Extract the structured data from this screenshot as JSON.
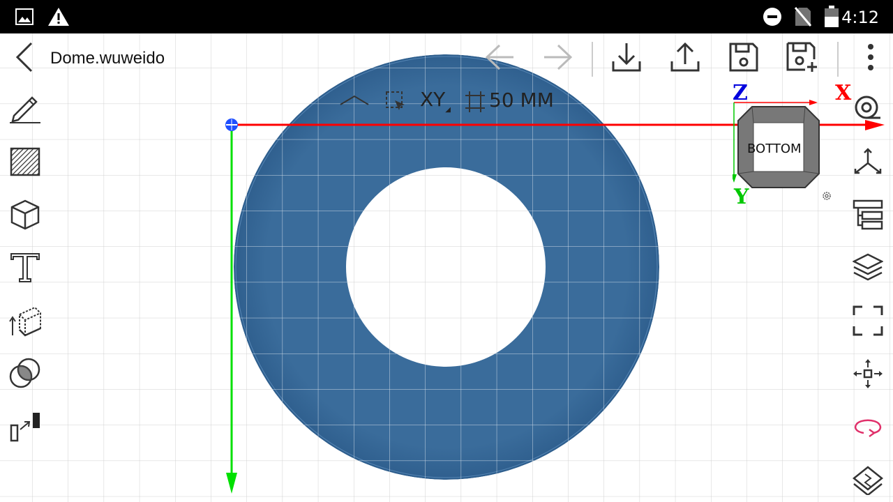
{
  "status_bar": {
    "icons": [
      "image-icon",
      "warning-icon",
      "do-not-disturb-icon",
      "no-sim-icon",
      "battery-icon"
    ],
    "time": "4:12"
  },
  "toolbar": {
    "back_icon": "chevron-left-icon",
    "title": "Dome.wuweido",
    "actions": [
      "undo-icon",
      "redo-icon",
      "import-icon",
      "export-icon",
      "save-icon",
      "save-as-icon",
      "more-icon"
    ]
  },
  "view_controls": {
    "collapse_icon": "chevron-up-icon",
    "select_icon": "select-box-icon",
    "plane": "XY",
    "grid_icon": "grid-size-icon",
    "grid_size": "50 MM"
  },
  "left_tools": [
    "sketch-icon",
    "hatch-icon",
    "solid-box-icon",
    "text-icon",
    "extrude-icon",
    "boolean-icon",
    "transform-icon"
  ],
  "right_tools": [
    "measure-icon",
    "axes-icon",
    "tree-icon",
    "layers-icon",
    "fit-view-icon",
    "move-icon",
    "rotate-icon",
    "mirror-icon"
  ],
  "view_cube": {
    "face_label": "BOTTOM",
    "axis_x": "X",
    "axis_y": "Y",
    "axis_z": "Z",
    "settings_icon": "gear-icon"
  },
  "colors": {
    "shape_fill": "#3a6c9b",
    "grid": "#d0d0d0",
    "x_axis": "#ff0000",
    "y_axis": "#00e000",
    "z_axis": "#0000dd",
    "rotate_icon": "#e0306a"
  }
}
